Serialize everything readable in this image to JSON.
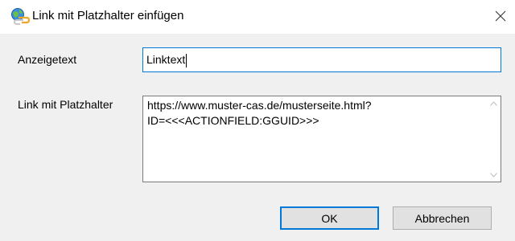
{
  "window": {
    "title": "Link mit Platzhalter einfügen",
    "icon": "link-globe-icon",
    "close_icon": "close-icon"
  },
  "form": {
    "display_text_label": "Anzeigetext",
    "display_text_value": "Linktext",
    "link_label": "Link mit Platzhalter",
    "link_value": "https://www.muster-cas.de/musterseite.html?\nID=<<<ACTIONFIELD:GGUID>>>"
  },
  "buttons": {
    "ok_label": "OK",
    "cancel_label": "Abbrechen"
  },
  "colors": {
    "focus_accent": "#0078d7",
    "client_background": "#f0f0f0",
    "button_background": "#e1e1e1"
  }
}
